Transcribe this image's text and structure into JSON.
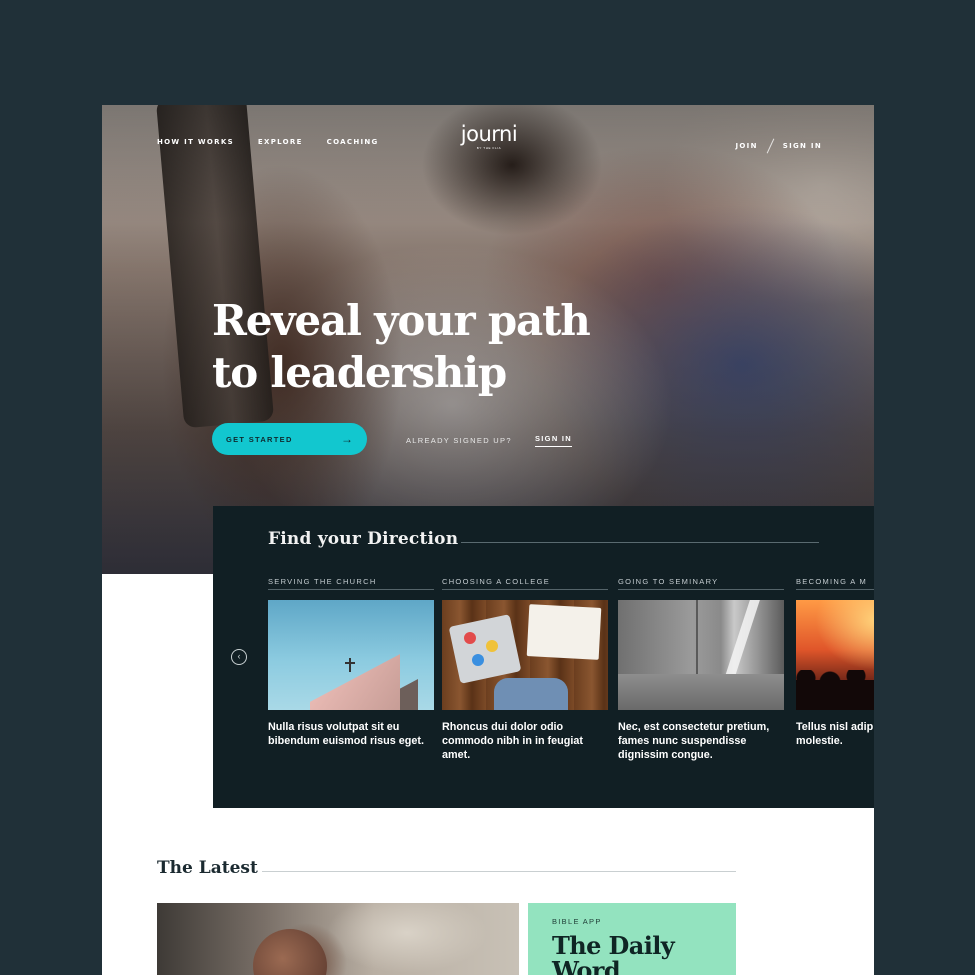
{
  "nav": {
    "left": [
      "HOW IT WORKS",
      "EXPLORE",
      "COACHING"
    ],
    "logo_main": "journi",
    "logo_sub": "BY THE FLIA",
    "join": "JOIN",
    "sign_in": "SIGN IN"
  },
  "hero": {
    "title_line1": "Reveal your path",
    "title_line2": "to leadership",
    "cta_label": "GET STARTED",
    "already_label": "ALREADY SIGNED UP?",
    "sign_in_link": "SIGN IN"
  },
  "direction": {
    "title": "Find your Direction",
    "cards": [
      {
        "category": "SERVING THE CHURCH",
        "text": "Nulla risus volutpat sit eu bibendum euismod risus eget."
      },
      {
        "category": "CHOOSING A COLLEGE",
        "text": "Rhoncus dui dolor odio commodo nibh in in feugiat amet."
      },
      {
        "category": "GOING TO SEMINARY",
        "text": "Nec, est consectetur pretium, fames nunc suspendisse dignissim congue."
      },
      {
        "category": "BECOMING A M",
        "text": "Tellus nisl adip semper ipsum et molestie."
      }
    ]
  },
  "latest": {
    "title": "The Latest",
    "card_category": "BIBLE APP",
    "card_headline": "The Daily Word"
  },
  "colors": {
    "background": "#203038",
    "accent": "#12c7cf",
    "panel": "#111f24",
    "card_green": "#93e3bf"
  },
  "icons": [
    "arrow-right-icon",
    "chevron-left-icon"
  ]
}
